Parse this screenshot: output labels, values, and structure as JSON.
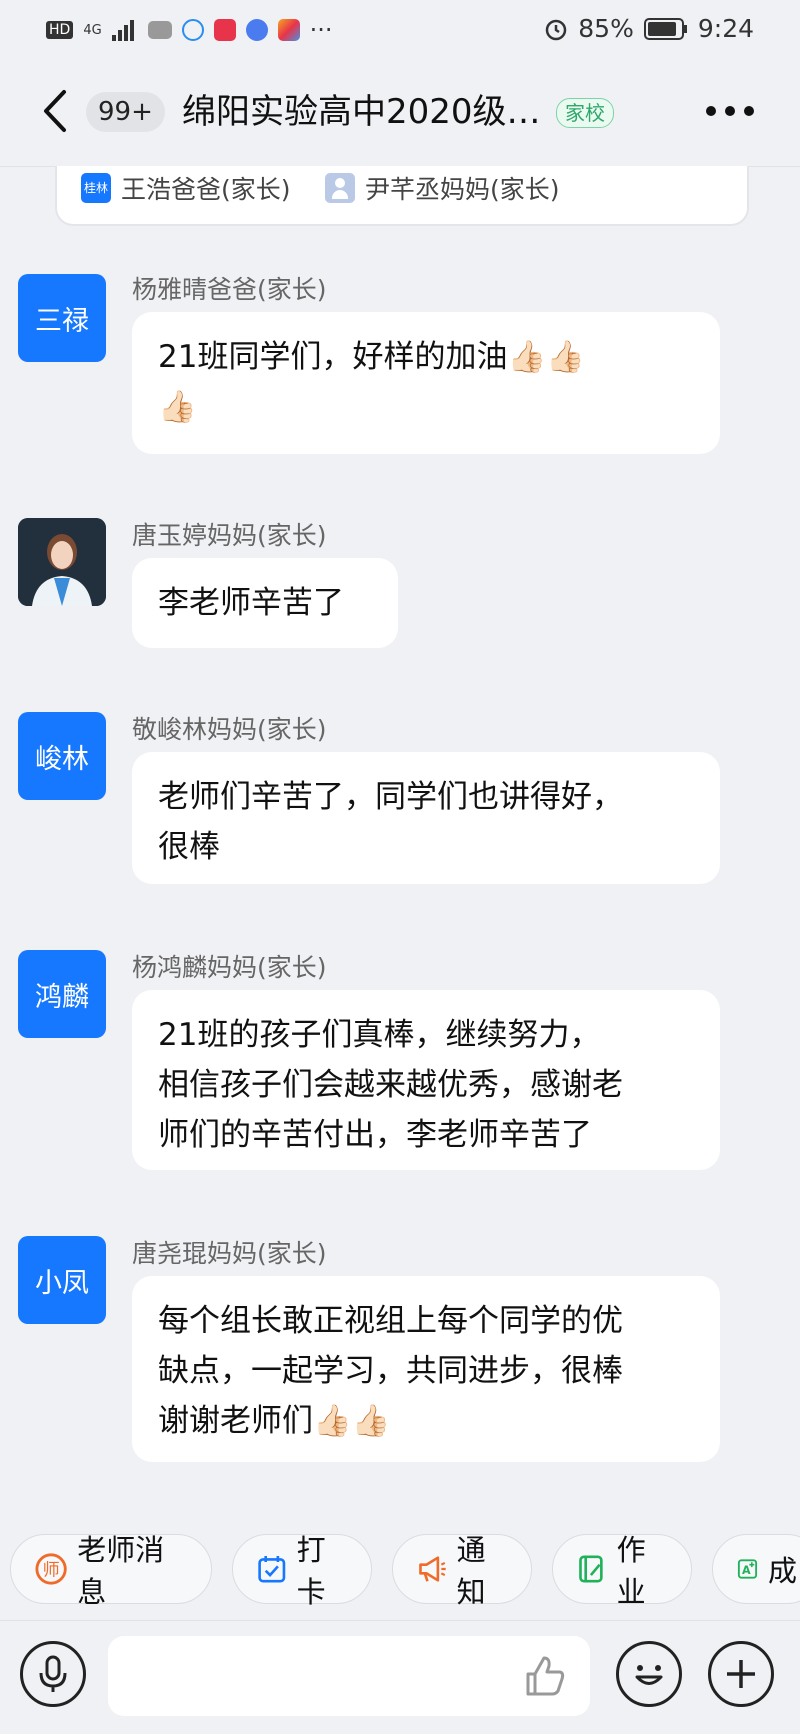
{
  "status_bar": {
    "network": "HD",
    "signal": "4G",
    "battery": "85%",
    "time": "9:24",
    "more": "···"
  },
  "header": {
    "unread_count": "99+",
    "title": "绵阳实验高中2020级…",
    "tag": "家校"
  },
  "member_card": {
    "members": [
      {
        "avatar_text": "桂林",
        "name": "王浩爸爸(家长)"
      },
      {
        "avatar_text": "",
        "name": "尹芊丞妈妈(家长)"
      }
    ]
  },
  "messages": [
    {
      "avatar_text": "三禄",
      "sender": "杨雅晴爸爸(家长)",
      "lines": [
        "21班同学们，好样的加油👍🏻👍🏻",
        "👍🏻"
      ]
    },
    {
      "avatar_text": "",
      "sender": "唐玉婷妈妈(家长)",
      "lines": [
        "李老师辛苦了"
      ]
    },
    {
      "avatar_text": "峻林",
      "sender": "敬峻林妈妈(家长)",
      "lines": [
        "老师们辛苦了，同学们也讲得好，",
        "很棒"
      ]
    },
    {
      "avatar_text": "鸿麟",
      "sender": "杨鸿麟妈妈(家长)",
      "lines": [
        "21班的孩子们真棒，继续努力，",
        "相信孩子们会越来越优秀，感谢老",
        "师们的辛苦付出，李老师辛苦了"
      ]
    },
    {
      "avatar_text": "小凤",
      "sender": "唐尧琨妈妈(家长)",
      "lines": [
        "每个组长敢正视组上每个同学的优",
        "缺点，一起学习，共同进步，很棒",
        "谢谢老师们👍🏻👍🏻"
      ]
    }
  ],
  "quick_actions": [
    {
      "label": "老师消息",
      "icon": "teacher-icon",
      "color": "#f06a2a"
    },
    {
      "label": "打卡",
      "icon": "calendar-check-icon",
      "color": "#1677ff"
    },
    {
      "label": "通知",
      "icon": "megaphone-icon",
      "color": "#f06a2a"
    },
    {
      "label": "作业",
      "icon": "homework-icon",
      "color": "#20b15a"
    },
    {
      "label": "成",
      "icon": "grade-icon",
      "color": "#20b15a"
    }
  ],
  "input_bar": {
    "voice_icon": "microphone-icon",
    "like_icon": "thumbs-up-icon",
    "emoji_icon": "emoji-icon",
    "plus_icon": "plus-icon"
  },
  "colors": {
    "accent": "#1677ff",
    "background": "#f0f1f4",
    "tag_green": "#2ea86a"
  }
}
